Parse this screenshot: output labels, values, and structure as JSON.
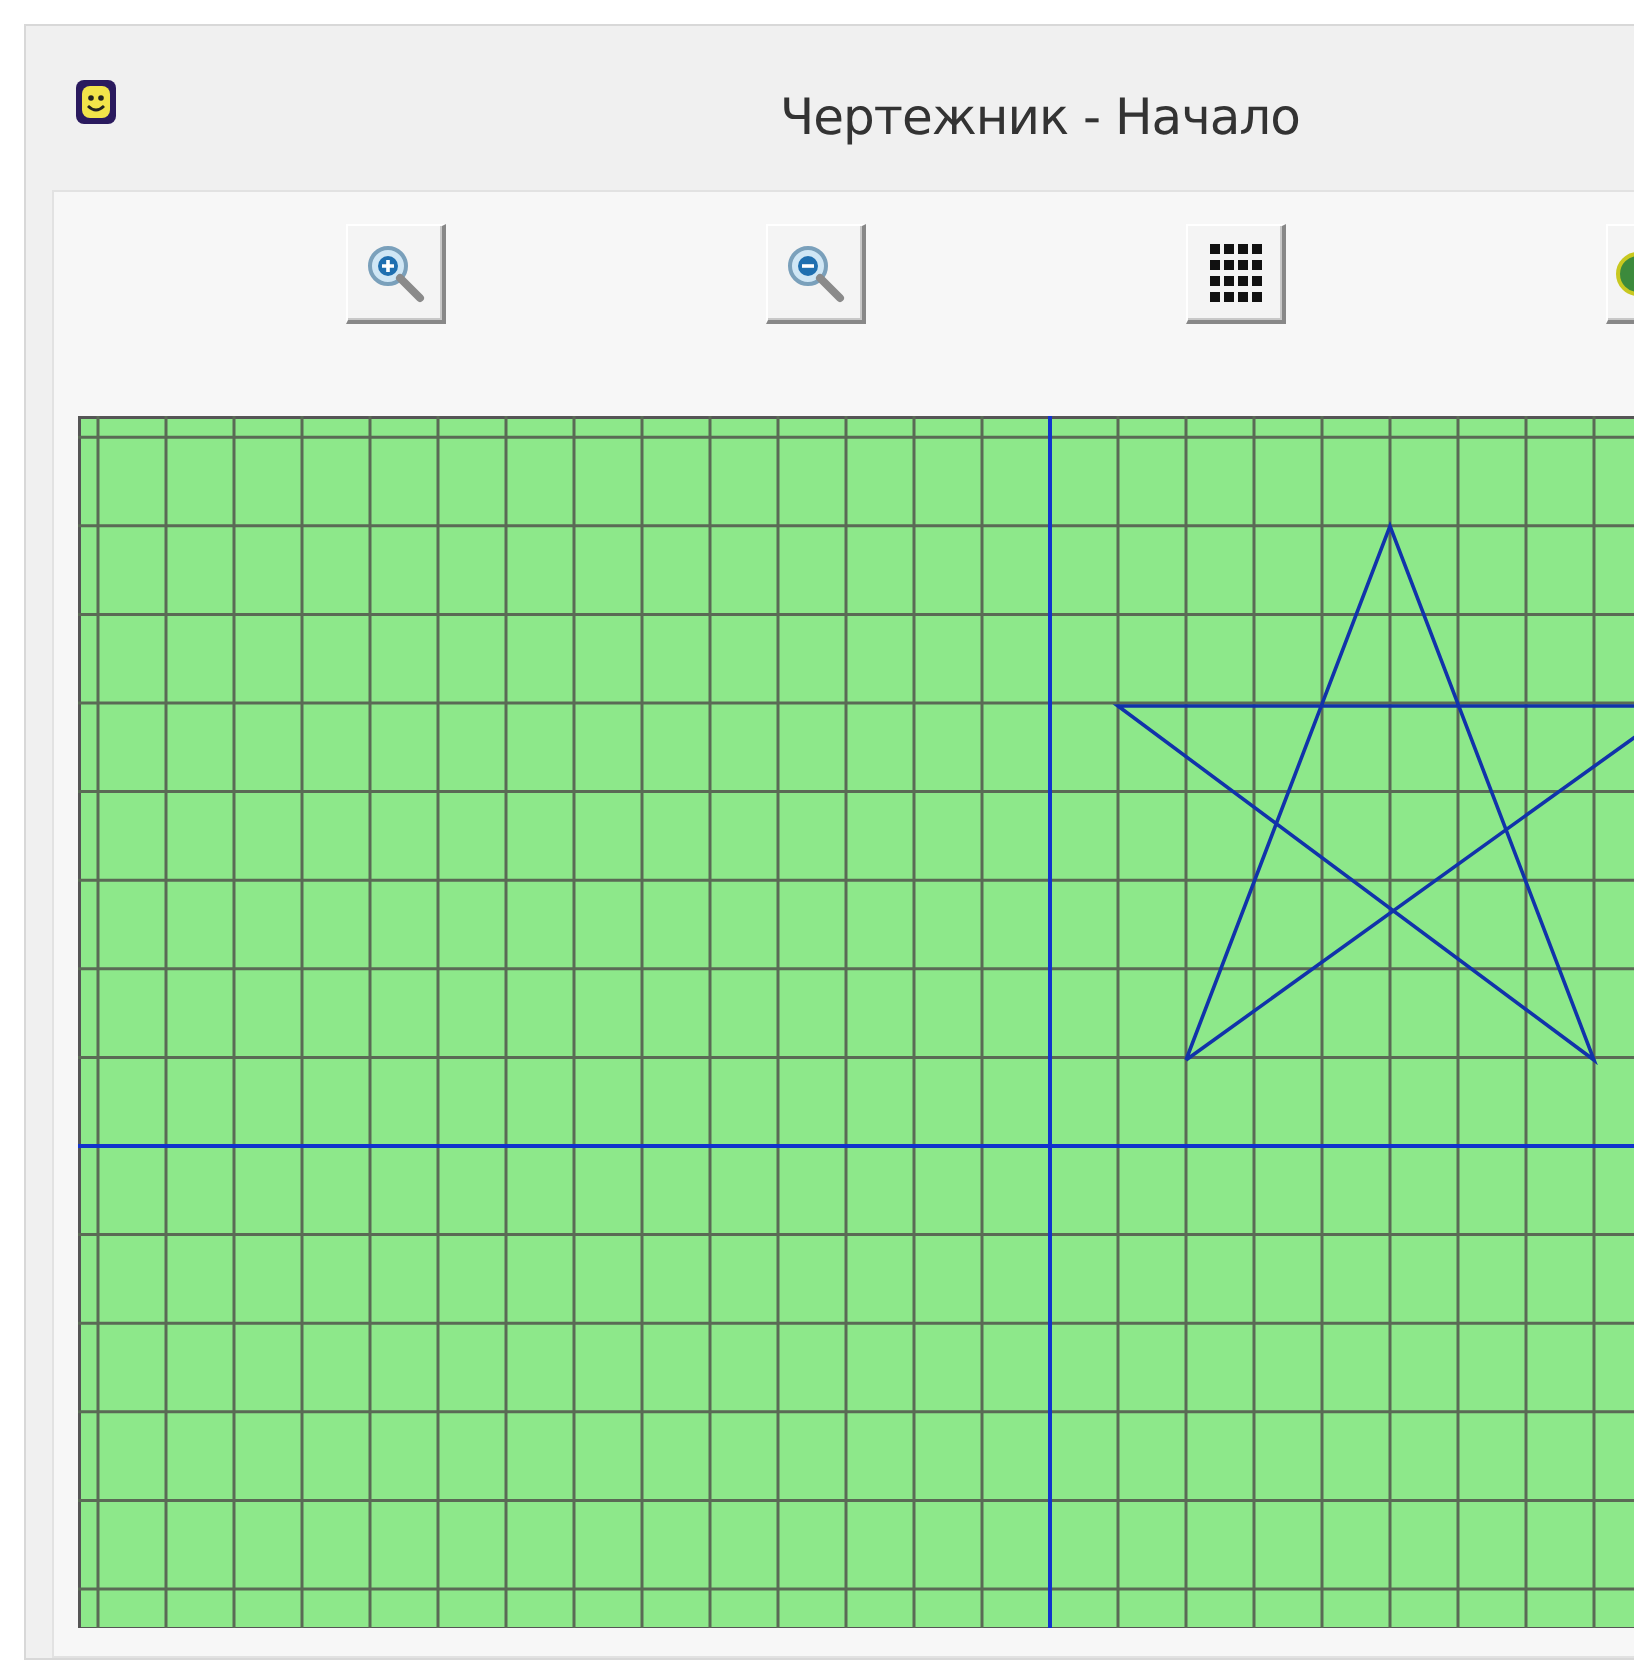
{
  "window": {
    "title": "Чертежник - Начало"
  },
  "toolbar": [
    {
      "kind": "zoom_in"
    },
    {
      "kind": "zoom_out"
    },
    {
      "kind": "grid"
    },
    {
      "kind": "picture_tool"
    }
  ]
}
